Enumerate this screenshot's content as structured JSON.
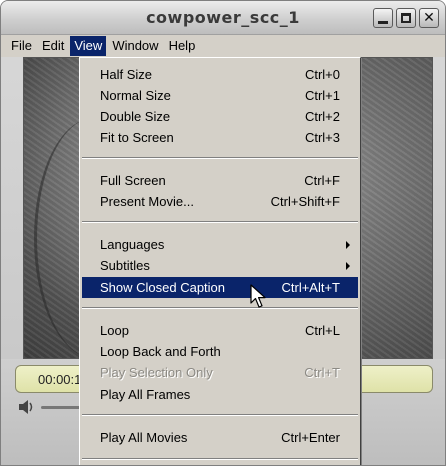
{
  "window": {
    "title": "cowpower_scc_1"
  },
  "menubar": {
    "items": [
      {
        "label": "File"
      },
      {
        "label": "Edit"
      },
      {
        "label": "View"
      },
      {
        "label": "Window"
      },
      {
        "label": "Help"
      }
    ],
    "active": "View"
  },
  "view_menu": {
    "items": [
      {
        "label": "Half Size",
        "shortcut": "Ctrl+0"
      },
      {
        "label": "Normal Size",
        "shortcut": "Ctrl+1"
      },
      {
        "label": "Double Size",
        "shortcut": "Ctrl+2"
      },
      {
        "label": "Fit to Screen",
        "shortcut": "Ctrl+3"
      },
      {
        "label": "Full Screen",
        "shortcut": "Ctrl+F"
      },
      {
        "label": "Present Movie...",
        "shortcut": "Ctrl+Shift+F"
      },
      {
        "label": "Languages",
        "shortcut": ""
      },
      {
        "label": "Subtitles",
        "shortcut": ""
      },
      {
        "label": "Show Closed Caption",
        "shortcut": "Ctrl+Alt+T"
      },
      {
        "label": "Loop",
        "shortcut": "Ctrl+L"
      },
      {
        "label": "Loop Back and Forth",
        "shortcut": ""
      },
      {
        "label": "Play Selection Only",
        "shortcut": "Ctrl+T"
      },
      {
        "label": "Play All Frames",
        "shortcut": ""
      },
      {
        "label": "Play All Movies",
        "shortcut": "Ctrl+Enter"
      }
    ],
    "highlighted": "Show Closed Caption",
    "disabled": [
      "Play Selection Only"
    ]
  },
  "controls": {
    "time": "00:00:1"
  },
  "icons": {
    "minimize": "minimize-icon",
    "maximize": "maximize-icon",
    "close": "close-icon",
    "volume": "speaker-icon",
    "submenu": "submenu-arrow-icon",
    "cursor": "mouse-pointer-icon"
  },
  "colors": {
    "highlight": "#0a246a",
    "menu_bg": "#d4d0c8",
    "lcd": "#e6e8b8"
  }
}
